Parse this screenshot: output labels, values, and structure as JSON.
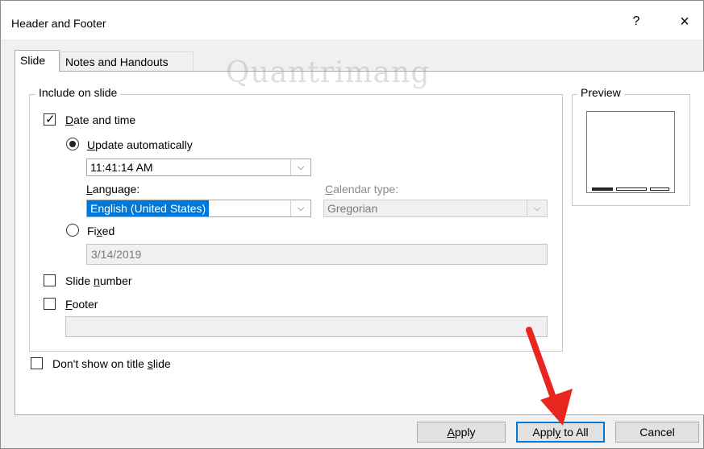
{
  "window": {
    "title": "Header and Footer",
    "help_label": "?",
    "close_label": "×"
  },
  "tabs": [
    {
      "label": "Slide",
      "active": true
    },
    {
      "label": "Notes and Handouts",
      "active": false
    }
  ],
  "watermark": "Quantrimang",
  "include_group": {
    "label": "Include on slide",
    "date_time": {
      "checked": true,
      "label_pre": "",
      "label_underline": "D",
      "label_post": "ate and time",
      "update_auto": {
        "selected": true,
        "label_underline": "U",
        "label_post": "pdate automatically",
        "time_value": "11:41:14 AM"
      },
      "language": {
        "label_underline": "L",
        "label_post": "anguage:",
        "value": "English (United States)"
      },
      "calendar": {
        "label_underline": "C",
        "label_post": "alendar type:",
        "value": "Gregorian"
      },
      "fixed": {
        "selected": false,
        "label_pre": "Fi",
        "label_underline": "x",
        "label_post": "ed",
        "value": "3/14/2019"
      }
    },
    "slide_number": {
      "checked": false,
      "label_pre": "Slide ",
      "label_underline": "n",
      "label_post": "umber"
    },
    "footer": {
      "checked": false,
      "label_underline": "F",
      "label_post": "ooter",
      "value": ""
    }
  },
  "dont_show": {
    "checked": false,
    "label_pre": "Don't show on title ",
    "label_underline": "s",
    "label_post": "lide"
  },
  "preview": {
    "label": "Preview"
  },
  "buttons": {
    "apply": {
      "label_underline": "A",
      "label_post": "pply"
    },
    "apply_all": {
      "label_pre": "Appl",
      "label_underline": "y",
      "label_post": " to All"
    },
    "cancel": {
      "label": "Cancel"
    }
  },
  "colors": {
    "accent": "#0078d7",
    "annotation_arrow": "#e8261f"
  }
}
